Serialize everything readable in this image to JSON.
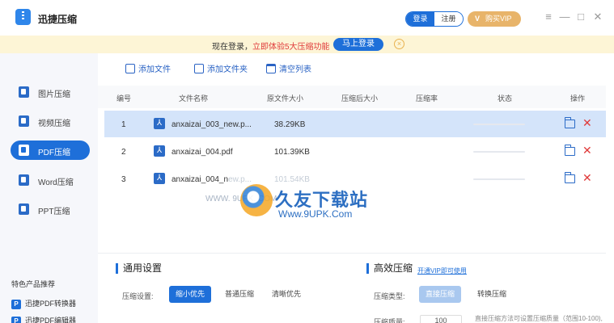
{
  "app": {
    "title": "迅捷压缩"
  },
  "header": {
    "login": "登录",
    "register": "注册",
    "vip": "购买VIP",
    "vip_mark": "V"
  },
  "notice": {
    "text": "现在登录，",
    "highlight": "立即体验5大压缩功能",
    "button": "马上登录"
  },
  "sidebar": {
    "items": [
      {
        "label": "图片压缩"
      },
      {
        "label": "视频压缩"
      },
      {
        "label": "PDF压缩"
      },
      {
        "label": "Word压缩"
      },
      {
        "label": "PPT压缩"
      }
    ],
    "featured_title": "特色产品推荐",
    "featured": [
      {
        "label": "迅捷PDF转换器",
        "icon_letter": "P"
      },
      {
        "label": "迅捷PDF编辑器",
        "icon_letter": "P"
      }
    ]
  },
  "toolbar": {
    "add_file": "添加文件",
    "add_folder": "添加文件夹",
    "clear_list": "清空列表"
  },
  "table": {
    "columns": [
      "编号",
      "文件名称",
      "原文件大小",
      "压缩后大小",
      "压缩率",
      "状态",
      "操作"
    ],
    "rows": [
      {
        "index": "1",
        "name": "anxaizai_003_new.p...",
        "size": "38.29KB",
        "selected": true
      },
      {
        "index": "2",
        "name": "anxaizai_004.pdf",
        "size": "101.39KB",
        "selected": false
      },
      {
        "index": "3",
        "name": "anxaizai_004_n",
        "name_faded": "ew.p...",
        "size": "101.54KB",
        "selected": false
      }
    ]
  },
  "watermark": {
    "cn": "久友下载站",
    "en": "Www.9UPK.Com",
    "left": "WWW. 9UPK. COM"
  },
  "settings": {
    "general_title": "通用设置",
    "compress_label": "压缩设置:",
    "options": [
      "缩小优先",
      "普通压缩",
      "清晰优先"
    ],
    "efficient_title": "高效压缩",
    "vip_link": "开通VIP即可使用",
    "type_label": "压缩类型:",
    "types": [
      "直接压缩",
      "转换压缩"
    ],
    "quality_label": "压缩质量:",
    "quality_value": "100",
    "hint": "直接压缩方法可设置压缩质量（范围10-100),"
  }
}
